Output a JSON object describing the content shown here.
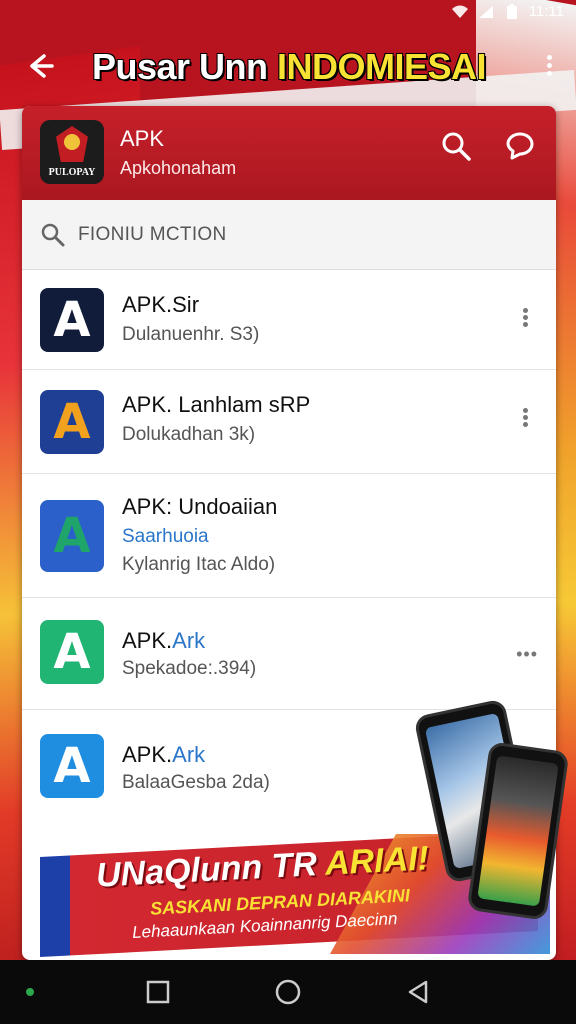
{
  "status": {
    "time": "11:11"
  },
  "topbar": {
    "title_main": "Pusar Unn ",
    "title_highlight": "INDOMIESAI"
  },
  "app_header": {
    "title": "APK",
    "subtitle": "Apkohonaham",
    "logo_text": "PULOPAY"
  },
  "search": {
    "placeholder": "FIONIU MCTION"
  },
  "list": [
    {
      "name": "APK.Sir",
      "sub": "Dulanuenhr. S3)",
      "sub2": "",
      "icon_bg": "#111c3a",
      "icon_accent": "#ffffff",
      "menu": "kebab"
    },
    {
      "name": "APK. Lanhlam sRP",
      "sub": "Dolukadhan 3k)",
      "sub2": "",
      "icon_bg": "#1e3f94",
      "icon_accent": "#f2a11f",
      "menu": "kebab"
    },
    {
      "name": "APK: Undoaiian",
      "sub": "Saarhuoia",
      "sub2": "Kylanrig Itac Aldo)",
      "icon_bg": "#2b5fc9",
      "icon_accent": "#1fa46a",
      "menu": ""
    },
    {
      "name": "APK.",
      "name_accent": "Ark",
      "sub": "Spekadoe:.394)",
      "sub2": "",
      "icon_bg": "#21b574",
      "icon_accent": "#ffffff",
      "menu": "dots"
    },
    {
      "name": "APK.",
      "name_accent": "Ark",
      "sub": "BalaaGesba 2da)",
      "sub2": "",
      "icon_bg": "#1f8de0",
      "icon_accent": "#ffffff",
      "menu": ""
    }
  ],
  "promo": {
    "line1_main": "UNaQlunn TR ",
    "line1_highlight": "ARIAI!",
    "line2": "SASKANI DEPRAN DIARAKINI",
    "line3": "Lehaaunkaan Koainnanrig Daecinn"
  },
  "colors": {
    "brand_red": "#c6202a",
    "highlight_yellow": "#f8e233",
    "link_blue": "#2b76c9"
  }
}
